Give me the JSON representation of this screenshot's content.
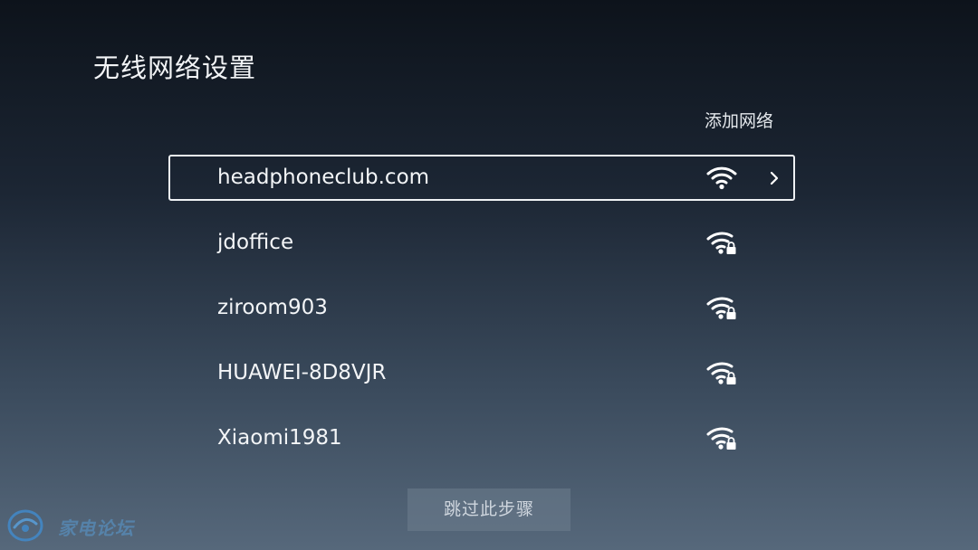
{
  "page": {
    "title": "无线网络设置",
    "add_network_label": "添加网络",
    "skip_label": "跳过此步骤"
  },
  "networks": [
    {
      "name": "headphoneclub.com",
      "secured": false,
      "focused": true,
      "icon": "wifi-icon"
    },
    {
      "name": "jdoffice",
      "secured": true,
      "focused": false,
      "icon": "wifi-lock-icon"
    },
    {
      "name": "ziroom903",
      "secured": true,
      "focused": false,
      "icon": "wifi-lock-icon"
    },
    {
      "name": "HUAWEI-8D8VJR",
      "secured": true,
      "focused": false,
      "icon": "wifi-lock-icon"
    },
    {
      "name": "Xiaomi1981",
      "secured": true,
      "focused": false,
      "icon": "wifi-lock-icon"
    }
  ],
  "watermark": {
    "text": "家电论坛",
    "icon": "forum-logo-icon"
  },
  "colors": {
    "text": "#ffffff",
    "focus_border": "#eef1f4",
    "skip_button_bg": "#6e7d8e",
    "watermark": "#5aa8e8"
  }
}
